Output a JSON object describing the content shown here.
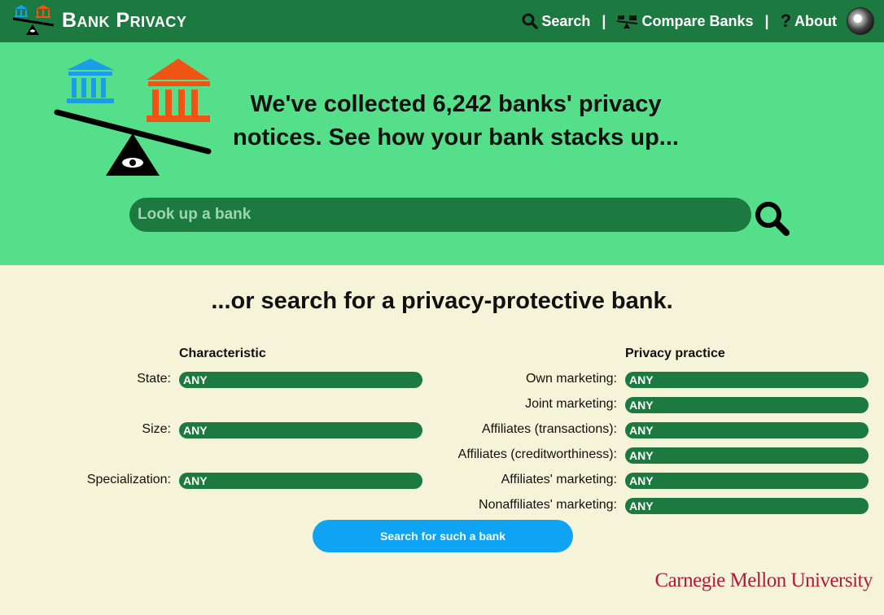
{
  "brand": {
    "title": "Bank Privacy",
    "logo_icon": "bank-scale-logo-icon"
  },
  "nav": {
    "search": {
      "label": "Search",
      "icon": "search-icon"
    },
    "separator": "|",
    "compare": {
      "label": "Compare Banks",
      "icon": "scale-icon"
    },
    "about": {
      "label": "About",
      "icon": "question-icon"
    },
    "avatar_icon": "avatar"
  },
  "hero": {
    "headline": "We've collected 6,242 banks' privacy notices. See how your bank stacks up...",
    "search_placeholder": "Look up a bank",
    "search_button_icon": "search-icon"
  },
  "filters": {
    "subheading": "...or search for a privacy-protective bank.",
    "characteristic": {
      "header": "Characteristic",
      "rows": [
        {
          "label": "State:",
          "value": "ANY"
        },
        {
          "label": "Size:",
          "value": "ANY"
        },
        {
          "label": "Specialization:",
          "value": "ANY"
        }
      ]
    },
    "privacy": {
      "header": "Privacy practice",
      "rows": [
        {
          "label": "Own marketing:",
          "value": "ANY"
        },
        {
          "label": "Joint marketing:",
          "value": "ANY"
        },
        {
          "label": "Affiliates (transactions):",
          "value": "ANY"
        },
        {
          "label": "Affiliates (creditworthiness):",
          "value": "ANY"
        },
        {
          "label": "Affiliates' marketing:",
          "value": "ANY"
        },
        {
          "label": "Nonaffiliates' marketing:",
          "value": "ANY"
        }
      ]
    },
    "submit_label": "Search for such a bank"
  },
  "footer": {
    "university": "Carnegie Mellon University"
  },
  "colors": {
    "nav_green": "#1c7a40",
    "hero_green": "#55df8a",
    "background": "#f5f3d8",
    "bank_blue": "#1a9ee8",
    "bank_orange": "#f05414",
    "button_blue": "#0ea4f3",
    "cmu_red": "#b31b34"
  }
}
